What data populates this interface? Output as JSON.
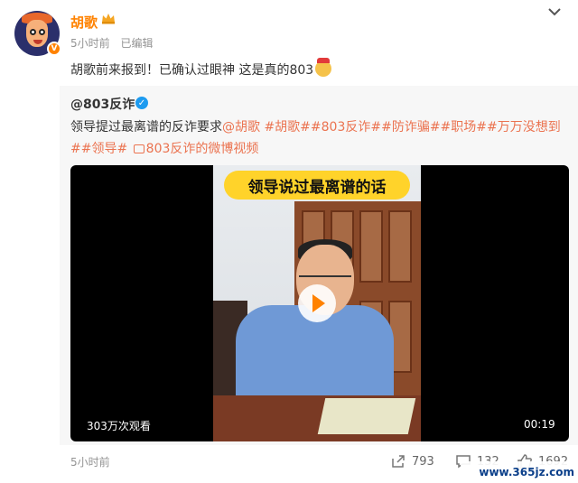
{
  "author": {
    "name": "胡歌",
    "time": "5小时前",
    "edited": "已编辑",
    "badge": "V"
  },
  "post": {
    "text": "胡歌前来报到！已确认过眼神 这是真的803"
  },
  "repost": {
    "author": "@803反诈",
    "text_plain": "领导提过最离谱的反诈要求",
    "mention": "@胡歌",
    "tags": "#胡歌##803反诈##防诈骗##职场##万万没想到##领导#",
    "video_link": "803反诈的微博视频",
    "video": {
      "banner": "领导说过最离谱的话",
      "views": "303万次观看",
      "duration": "00:19"
    }
  },
  "footer": {
    "time": "5小时前",
    "shares": "793",
    "comments": "132",
    "likes": "1692"
  },
  "watermark": "www.365jz.com",
  "colors": {
    "accent": "#ff8200",
    "link": "#eb7350",
    "verified": "#1d9bf0"
  }
}
